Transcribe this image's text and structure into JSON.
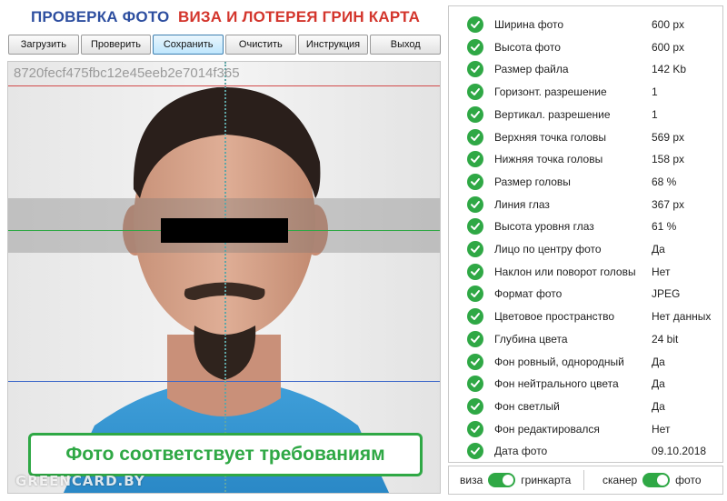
{
  "header": {
    "title_left": "ПРОВЕРКА ФОТО",
    "title_right": "ВИЗА И ЛОТЕРЕЯ ГРИН КАРТА"
  },
  "toolbar": {
    "load": "Загрузить",
    "check": "Проверить",
    "save": "Сохранить",
    "clear": "Очистить",
    "help": "Инструкция",
    "exit": "Выход"
  },
  "photo": {
    "id": "8720fecf475fbc12e45eeb2e7014f365",
    "watermark": "GREENCARD.BY",
    "result": "Фото соответствует требованиям"
  },
  "checks": [
    {
      "label": "Ширина фото",
      "value": "600 px"
    },
    {
      "label": "Высота фото",
      "value": "600 px"
    },
    {
      "label": "Размер файла",
      "value": "142 Kb"
    },
    {
      "label": "Горизонт. разрешение",
      "value": "1"
    },
    {
      "label": "Вертикал. разрешение",
      "value": "1"
    },
    {
      "label": "Верхняя точка головы",
      "value": "569 px"
    },
    {
      "label": "Нижняя точка головы",
      "value": "158 px"
    },
    {
      "label": "Размер головы",
      "value": "68 %"
    },
    {
      "label": "Линия глаз",
      "value": "367 px"
    },
    {
      "label": "Высота уровня глаз",
      "value": "61 %"
    },
    {
      "label": "Лицо по центру фото",
      "value": "Да"
    },
    {
      "label": "Наклон или поворот головы",
      "value": "Нет"
    },
    {
      "label": "Формат фото",
      "value": "JPEG"
    },
    {
      "label": "Цветовое пространство",
      "value": "Нет данных"
    },
    {
      "label": "Глубина цвета",
      "value": "24 bit"
    },
    {
      "label": "Фон ровный, однородный",
      "value": "Да"
    },
    {
      "label": "Фон нейтрального цвета",
      "value": "Да"
    },
    {
      "label": "Фон светлый",
      "value": "Да"
    },
    {
      "label": "Фон редактировался",
      "value": "Нет"
    },
    {
      "label": "Дата фото",
      "value": "09.10.2018"
    }
  ],
  "toggles": {
    "left_off": "виза",
    "left_on": "гринкарта",
    "right_off": "сканер",
    "right_on": "фото"
  },
  "colors": {
    "accent_green": "#2fa845",
    "title_blue": "#2e4fa0",
    "title_red": "#d3352c"
  }
}
